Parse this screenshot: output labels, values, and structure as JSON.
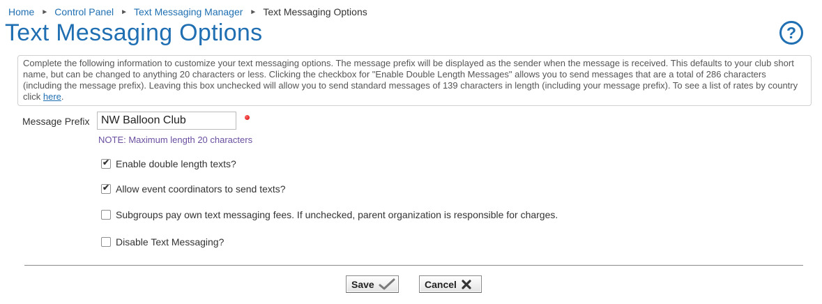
{
  "breadcrumb": {
    "items": [
      {
        "label": "Home"
      },
      {
        "label": "Control Panel"
      },
      {
        "label": "Text Messaging Manager"
      },
      {
        "label": "Text Messaging Options"
      }
    ],
    "separator_icon": "chevron-right-icon"
  },
  "page": {
    "title": "Text Messaging Options",
    "help_icon": "question-circle-icon",
    "help_glyph": "?"
  },
  "info": {
    "text": "Complete the following information to customize your text messaging options. The message prefix will be displayed as the sender when the message is received. This defaults to your club short name, but can be changed to anything 20 characters or less. Clicking the checkbox for \"Enable Double Length Messages\" allows you to send messages that are a total of 286 characters (including the message prefix). Leaving this box unchecked will allow you to send standard messages of 139 characters in length (including your message prefix). To see a list of rates by country click ",
    "link_label": "here",
    "trailing": "."
  },
  "form": {
    "prefix_label": "Message Prefix",
    "prefix_value": "NW Balloon Club",
    "note": "NOTE: Maximum length 20 characters",
    "options": [
      {
        "label": "Enable double length texts?",
        "checked": true
      },
      {
        "label": "Allow event coordinators to send texts?",
        "checked": true
      },
      {
        "label": "Subgroups pay own text messaging fees. If unchecked, parent organization is responsible for charges.",
        "checked": false
      },
      {
        "label": "Disable Text Messaging?",
        "checked": false
      }
    ]
  },
  "buttons": {
    "save_label": "Save",
    "save_icon": "checkmark-icon",
    "cancel_label": "Cancel",
    "cancel_icon": "x-icon"
  },
  "colors": {
    "accent": "#1f6fb2",
    "note": "#6a4fa0",
    "required": "#d40000"
  }
}
